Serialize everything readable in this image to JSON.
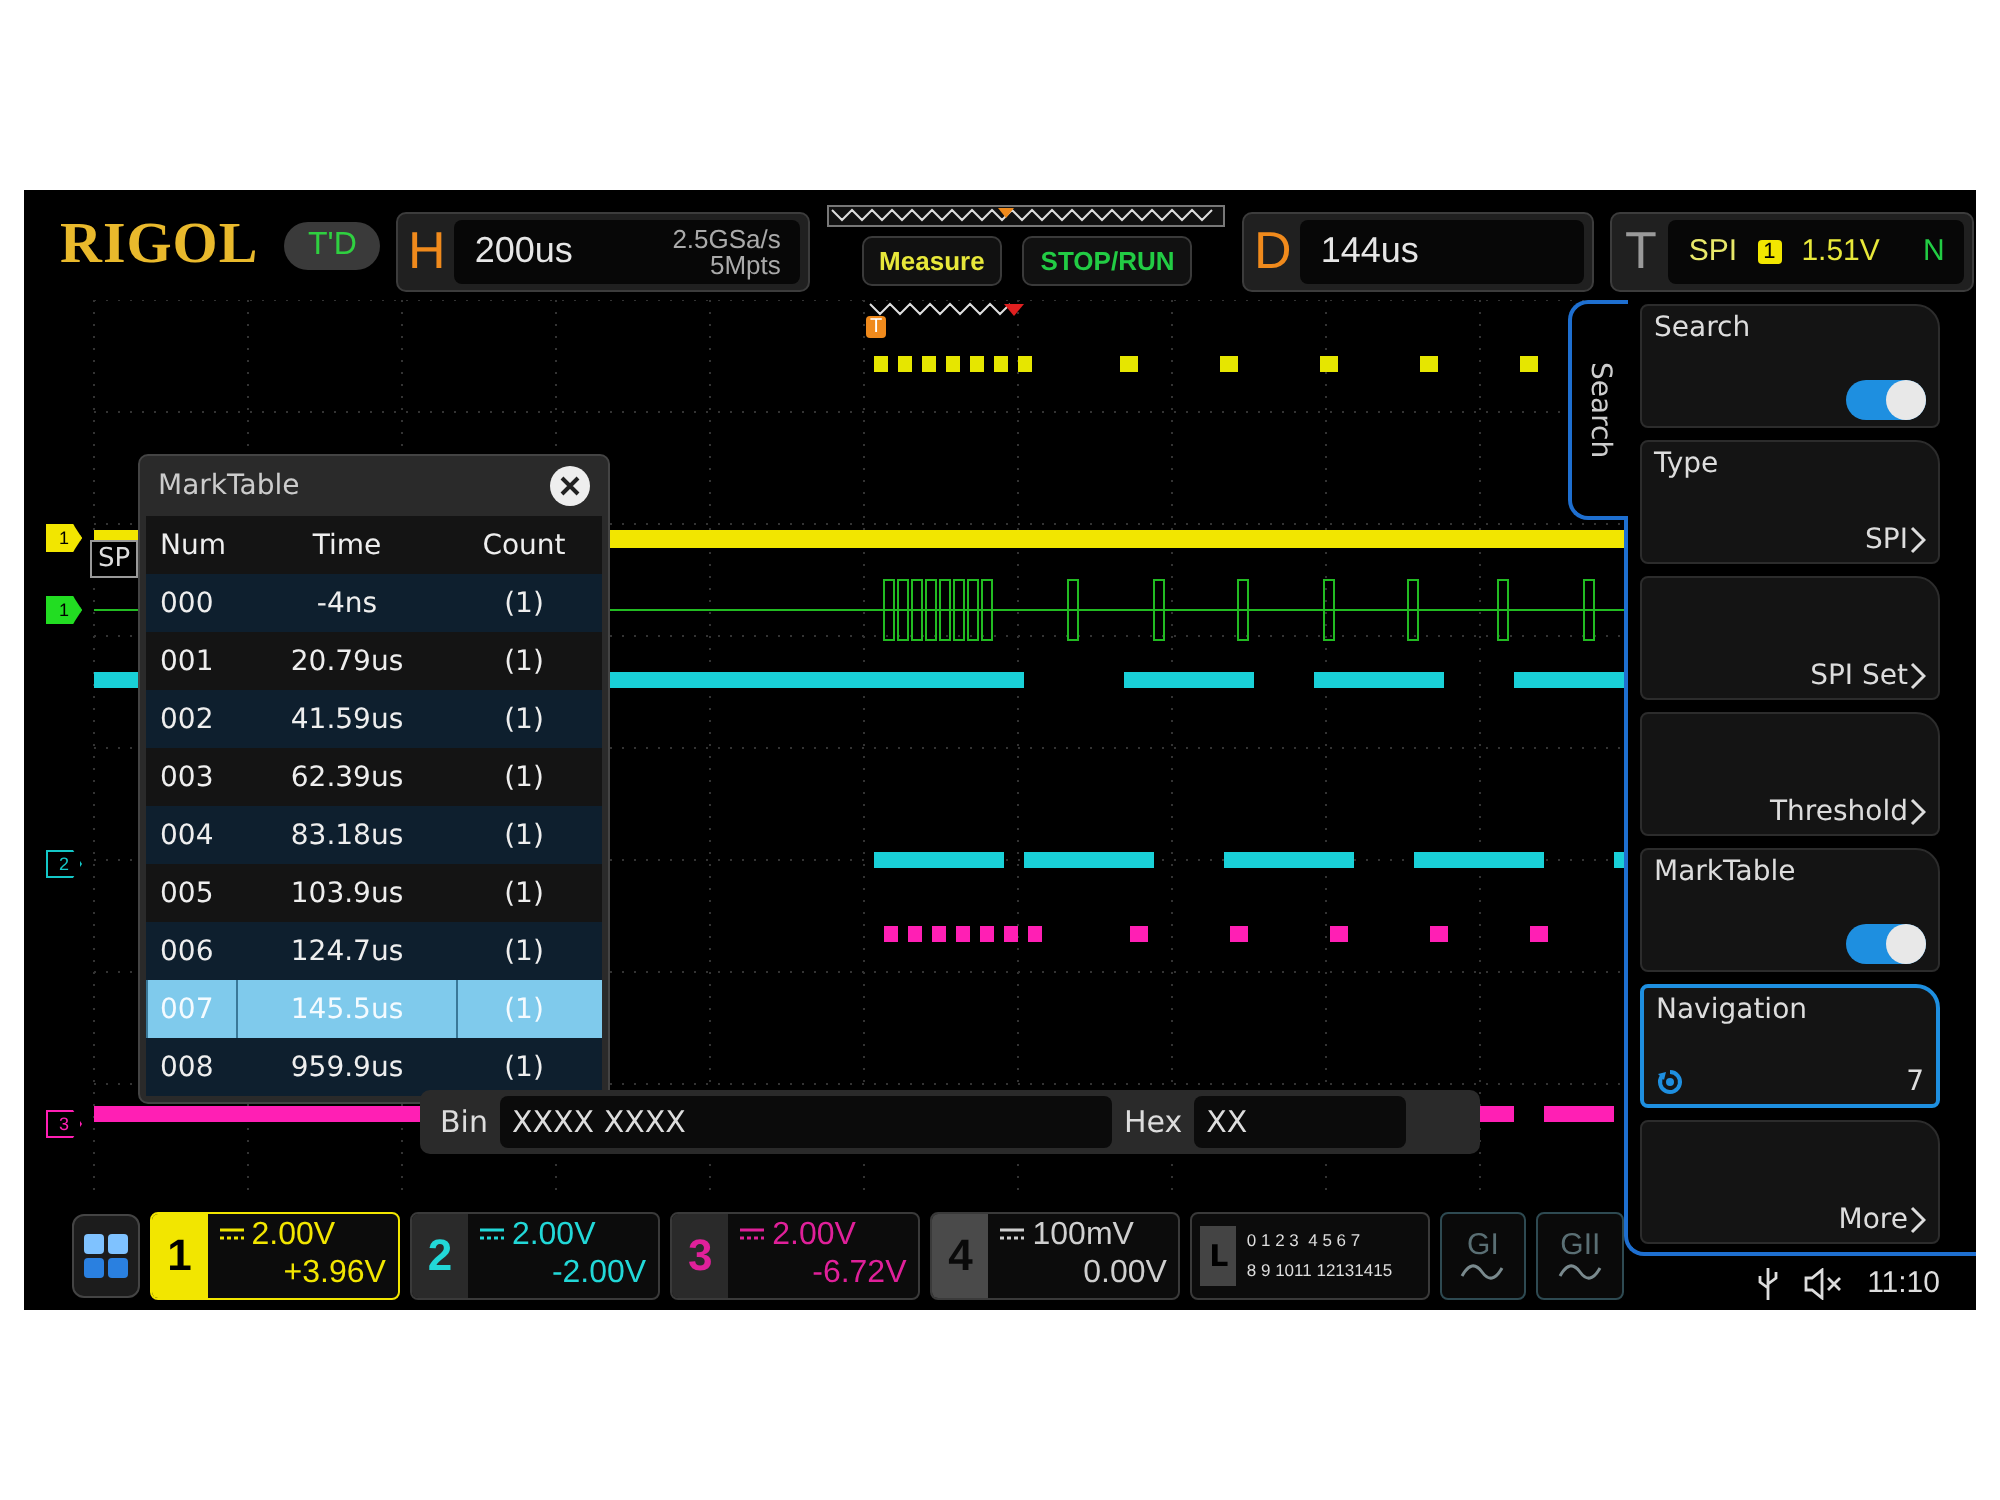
{
  "brand": {
    "logo": "RIGOL",
    "status": "T'D"
  },
  "horizontal": {
    "label": "H",
    "timebase": "200us",
    "sample_rate": "2.5GSa/s",
    "memory_depth": "5Mpts"
  },
  "buttons": [
    {
      "label": "Measure",
      "kind": "measure"
    },
    {
      "label": "STOP/RUN",
      "kind": "run"
    }
  ],
  "delay": {
    "label": "D",
    "value": "144us"
  },
  "trigger": {
    "label": "T",
    "type": "SPI",
    "source": "1",
    "voltage": "1.51V",
    "mode": "N"
  },
  "waveform": {
    "trigger_marker": "T",
    "bus_label": "SP",
    "channel_markers": [
      {
        "label": "1",
        "color": "#f2e600",
        "kind": "filled"
      },
      {
        "label": "1",
        "color": "#22dd22",
        "kind": "filled"
      },
      {
        "label": "2",
        "color": "#14c8c8",
        "kind": "outline"
      },
      {
        "label": "3",
        "color": "#ff1fb4",
        "kind": "outline"
      }
    ]
  },
  "mark_table": {
    "title": "MarkTable",
    "columns": [
      "Num",
      "Time",
      "Count"
    ],
    "rows": [
      {
        "num": "000",
        "time": "-4ns",
        "count": "(1)",
        "selected": false
      },
      {
        "num": "001",
        "time": "20.79us",
        "count": "(1)",
        "selected": false
      },
      {
        "num": "002",
        "time": "41.59us",
        "count": "(1)",
        "selected": false
      },
      {
        "num": "003",
        "time": "62.39us",
        "count": "(1)",
        "selected": false
      },
      {
        "num": "004",
        "time": "83.18us",
        "count": "(1)",
        "selected": false
      },
      {
        "num": "005",
        "time": "103.9us",
        "count": "(1)",
        "selected": false
      },
      {
        "num": "006",
        "time": "124.7us",
        "count": "(1)",
        "selected": false
      },
      {
        "num": "007",
        "time": "145.5us",
        "count": "(1)",
        "selected": true
      },
      {
        "num": "008",
        "time": "959.9us",
        "count": "(1)",
        "selected": false
      }
    ]
  },
  "decode_bar": {
    "bin_label": "Bin",
    "bin_value": "XXXX XXXX",
    "hex_label": "Hex",
    "hex_value": "XX"
  },
  "menu": {
    "tab": "Search",
    "items": [
      {
        "kind": "toggle",
        "label": "Search",
        "on": true,
        "selected": false
      },
      {
        "kind": "link",
        "label": "Type",
        "value": "SPI",
        "selected": false
      },
      {
        "kind": "link",
        "value": "SPI Set",
        "selected": false
      },
      {
        "kind": "link",
        "value": "Threshold",
        "selected": false
      },
      {
        "kind": "toggle",
        "label": "MarkTable",
        "on": true,
        "selected": false
      },
      {
        "kind": "knob",
        "label": "Navigation",
        "value": "7",
        "selected": true
      },
      {
        "kind": "link",
        "value": "More",
        "selected": false
      }
    ]
  },
  "channels": [
    {
      "number": "1",
      "scale": "2.00V",
      "offset": "+3.96V",
      "color": "#f2e600",
      "active": true,
      "enabled": true
    },
    {
      "number": "2",
      "scale": "2.00V",
      "offset": "-2.00V",
      "color": "#22d8d8",
      "active": false,
      "enabled": true
    },
    {
      "number": "3",
      "scale": "2.00V",
      "offset": "-6.72V",
      "color": "#e0209a",
      "active": false,
      "enabled": true
    },
    {
      "number": "4",
      "scale": "100mV",
      "offset": "0.00V",
      "color": "#d8d8d8",
      "active": false,
      "enabled": false
    }
  ],
  "logic": {
    "label": "L",
    "row_1": "0 1 2 3  4 5 6 7",
    "row_2": "8 9 1011 12131415"
  },
  "generators": [
    {
      "label": "GI"
    },
    {
      "label": "GII"
    }
  ],
  "status": {
    "time": "11:10"
  }
}
